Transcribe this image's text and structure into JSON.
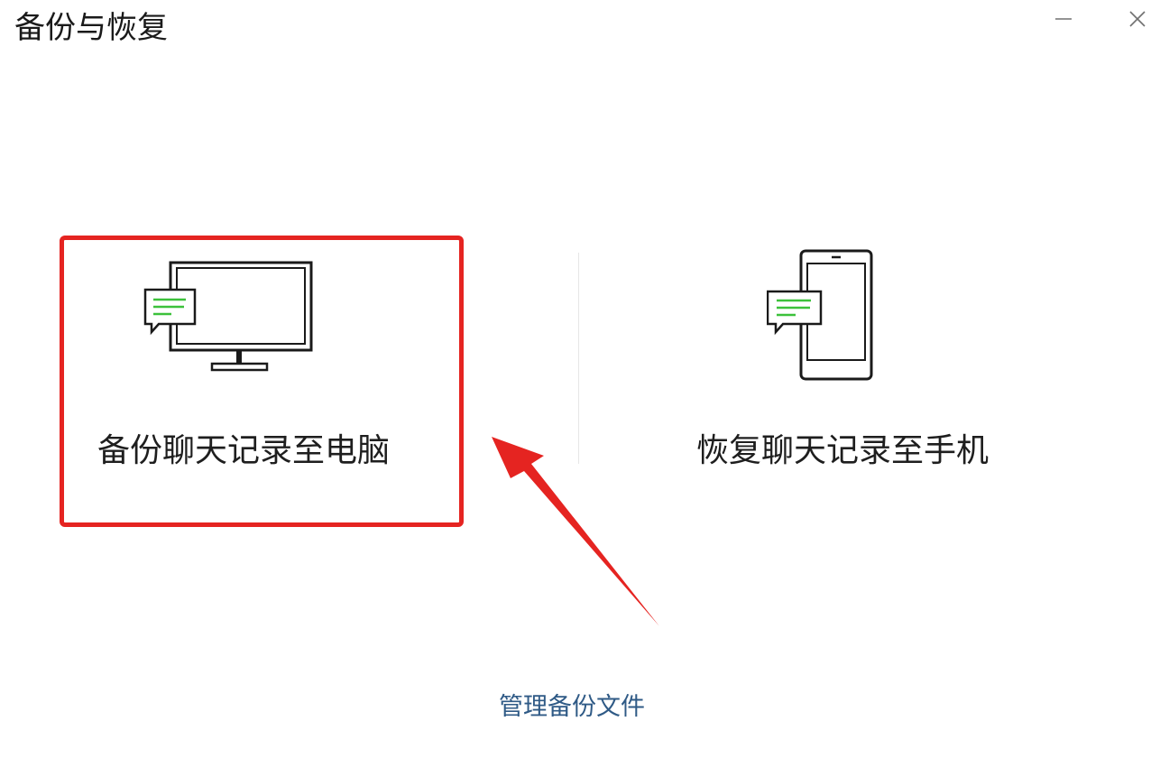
{
  "window": {
    "title": "备份与恢复",
    "minimize_icon": "minimize-icon",
    "close_icon": "close-icon"
  },
  "options": [
    {
      "label": "备份聊天记录至电脑",
      "icon": "monitor-chat-icon",
      "highlighted": true
    },
    {
      "label": "恢复聊天记录至手机",
      "icon": "phone-chat-icon",
      "highlighted": false
    }
  ],
  "footer": {
    "manage_link": "管理备份文件"
  },
  "colors": {
    "highlight": "#e52421",
    "accent_green": "#3cc13b",
    "link": "#2f5a86",
    "icon_stroke": "#1a1a1a"
  },
  "annotation": {
    "arrow_icon": "red-arrow-icon"
  }
}
